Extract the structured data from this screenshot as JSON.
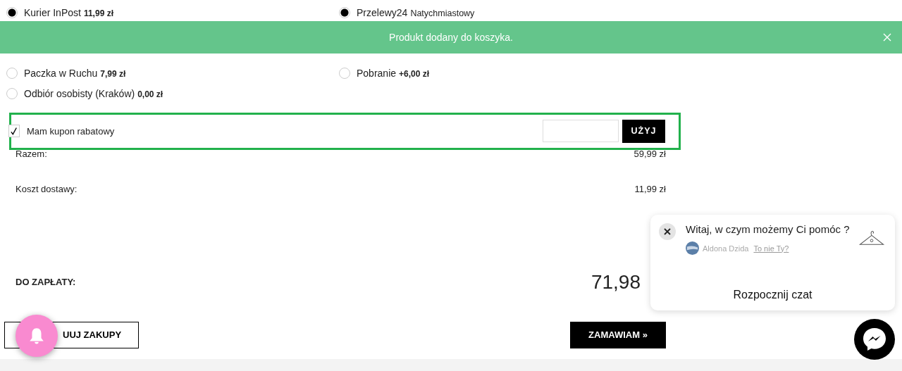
{
  "shipping": [
    {
      "name": "Kurier InPost",
      "price": "11,99 zł",
      "selected": true
    },
    {
      "name": "Paczka w Ruchu",
      "price": "7,99 zł",
      "selected": false
    },
    {
      "name": "Odbiór osobisty (Kraków)",
      "price": "0,00 zł",
      "selected": false
    }
  ],
  "payment": [
    {
      "name": "Przelewy24",
      "note": "Natychmiastowy",
      "selected": true
    },
    {
      "name": "Pobranie",
      "price": "+6,00 zł",
      "selected": false
    }
  ],
  "toast": {
    "message": "Produkt dodany do koszyka."
  },
  "coupon": {
    "label": "Mam kupon rabatowy",
    "checked": true,
    "button": "UŻYJ"
  },
  "summary": [
    {
      "label": "Razem:",
      "value": "59,99 zł"
    },
    {
      "label": "Koszt dostawy:",
      "value": "11,99 zł"
    }
  ],
  "total": {
    "label": "DO ZAPŁATY:",
    "value": "71,98"
  },
  "buttons": {
    "continue": "UUJ ZAKUPY",
    "order": "ZAMAWIAM »"
  },
  "chat": {
    "greeting": "Witaj, w czym możemy Ci pomóc ?",
    "agent": "Aldona Dzida",
    "switch_link": "To nie Ty?",
    "start": "Rozpocznij czat"
  }
}
